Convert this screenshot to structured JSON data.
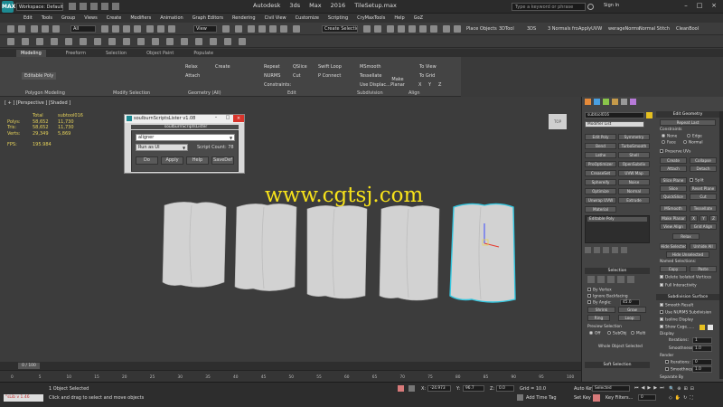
{
  "window": {
    "logo": "MAX",
    "workspace": "Workspace: Default",
    "title": "Autodesk 3ds Max 2016",
    "file": "TileSetup.max",
    "search_placeholder": "Type a keyword or phrase",
    "signin": "Sign In"
  },
  "menu": [
    "Edit",
    "Tools",
    "Group",
    "Views",
    "Create",
    "Modifiers",
    "Animation",
    "Graph Editors",
    "Rendering",
    "Civil View",
    "Customize",
    "Scripting",
    "CryMaxTools",
    "Help",
    "GoZ"
  ],
  "toolbar": {
    "filter": "All",
    "view": "View",
    "selection_set": "Create Selection Se",
    "items": [
      "Place Objects",
      "3DTool",
      "3DS",
      "3 Normals fro",
      "ApplyUVW",
      "werageNorms",
      "Normal Stitch",
      "CleanBool"
    ]
  },
  "ribbon": {
    "tabs": [
      "Modeling",
      "Freeform",
      "Selection",
      "Object Paint",
      "Populate"
    ],
    "editable_poly": "Editable Poly",
    "polygon_modeling": "Polygon Modeling",
    "modify_selection": "Modify Selection",
    "geometry": "Geometry (All)",
    "edit": "Edit",
    "subdivision": "Subdivision",
    "align": "Align",
    "relax": "Relax",
    "create": "Create",
    "attach": "Attach",
    "repeat": "Repeat",
    "qslice": "QSlice",
    "swift_loop": "Swift Loop",
    "nurms": "NURMS",
    "cut": "Cut",
    "p_connect": "P Connect",
    "constraints": "Constraints:",
    "msmooth": "MSmooth",
    "tessellate": "Tessellate",
    "use_displace": "Use Displac...",
    "make_planar": "Make Planar",
    "to_view": "To View",
    "to_grid": "To Grid",
    "x": "X",
    "y": "Y",
    "z": "Z"
  },
  "viewport": {
    "label": "[ + ] [Perspective ] [Shaded ]",
    "stats": {
      "total_label": "Total",
      "object_label": "subtool016",
      "polys_label": "Polys:",
      "polys_total": "58,652",
      "polys_obj": "11,730",
      "tris_label": "Tris:",
      "tris_total": "58,652",
      "tris_obj": "11,730",
      "verts_label": "Verts:",
      "verts_total": "29,349",
      "verts_obj": "5,869",
      "fps_label": "FPS:",
      "fps": "195.984"
    },
    "viewcube": "TOP"
  },
  "dialog": {
    "title": "soulburnScriptsLister v1.08",
    "header": "soulburnScriptsLister",
    "input_value": "aligner",
    "mode": "Run as UI",
    "count": "Script Count: 78",
    "buttons": [
      "Do",
      "Apply",
      "Help",
      "SaveDef"
    ]
  },
  "watermark": "www.cgtsj.com",
  "timeline": {
    "frame": "0 / 100",
    "ticks": [
      "0",
      "5",
      "10",
      "15",
      "20",
      "25",
      "30",
      "35",
      "40",
      "45",
      "50",
      "55",
      "60",
      "65",
      "70",
      "75",
      "80",
      "85",
      "90",
      "95",
      "100"
    ]
  },
  "status": {
    "maxscript": "\"sLib v 1.46",
    "selected": "1 Object Selected",
    "prompt": "Click and drag to select and move objects",
    "x_label": "X:",
    "x": "-24.973",
    "y_label": "Y:",
    "y": "96.7",
    "z_label": "Z:",
    "z": "0.0",
    "grid": "Grid = 10.0",
    "add_time_tag": "Add Time Tag",
    "auto_key": "Auto Key",
    "selected_mode": "Selected",
    "set_key": "Set Key",
    "key_filters": "Key Filters...",
    "frame_value": "0"
  },
  "command_panel": {
    "object_name": "subtool016",
    "modifier_list": "Modifier List",
    "modifier_buttons": [
      "Edit Poly",
      "Symmetry",
      "Bend",
      "TurboSmooth",
      "Lathe",
      "Shell",
      "ProOptimizer",
      "OpenSubdiv",
      "CreaseSet",
      "UVW Map",
      "Sphereify",
      "Noise",
      "Optimize",
      "Normal",
      "Unwrap UVW",
      "Extrude",
      "Material"
    ],
    "stack_item": "Editable Poly",
    "selection_header": "Selection",
    "by_vertex": "By Vertex",
    "ignore_backfacing": "Ignore Backfacing",
    "by_angle": "By Angle:",
    "by_angle_value": "45.0",
    "shrink": "Shrink",
    "grow": "Grow",
    "ring": "Ring",
    "loop": "Loop",
    "preview_selection": "Preview Selection",
    "off": "Off",
    "subobj": "SubObj",
    "multi": "Multi",
    "whole_object": "Whole Object Selected",
    "soft_selection": "Soft Selection",
    "edit_geometry": "Edit Geometry",
    "repeat_last": "Repeat Last",
    "constraints": "Constraints",
    "none": "None",
    "edge": "Edge",
    "face": "Face",
    "normal": "Normal",
    "preserve_uvs": "Preserve UVs",
    "create": "Create",
    "collapse": "Collapse",
    "attach": "Attach",
    "detach": "Detach",
    "slice_plane": "Slice Plane",
    "split": "Split",
    "slice": "Slice",
    "reset_plane": "Reset Plane",
    "quickslice": "QuickSlice",
    "cut": "Cut",
    "msmooth": "MSmooth",
    "tessellate": "Tessellate",
    "make_planar": "Make Planar",
    "x": "X",
    "y": "Y",
    "z": "Z",
    "view_align": "View Align",
    "grid_align": "Grid Align",
    "relax": "Relax",
    "hide_selected": "Hide Selected",
    "unhide_all": "Unhide All",
    "hide_unselected": "Hide Unselected",
    "named_selections": "Named Selections:",
    "copy": "Copy",
    "paste": "Paste",
    "delete_isolated": "Delete Isolated Vertices",
    "full_interactivity": "Full Interactivity",
    "subdivision_surface": "Subdivision Surface",
    "smooth_result": "Smooth Result",
    "use_nurms": "Use NURMS Subdivision",
    "isoline_display": "Isoline Display",
    "show_cage": "Show Cage......",
    "display": "Display",
    "iterations_label": "Iterations:",
    "iterations": "1",
    "smoothness_label": "Smoothness:",
    "smoothness": "1.0",
    "render": "Render",
    "render_iterations": "0",
    "render_smoothness": "1.0",
    "separate_by": "Separate By"
  },
  "colors": {
    "accent_teal": "#1d8a92",
    "watermark": "#f7e21a",
    "stats": "#e6d25a",
    "selection_cyan": "#35c7e0",
    "close_red": "#d9342b"
  }
}
